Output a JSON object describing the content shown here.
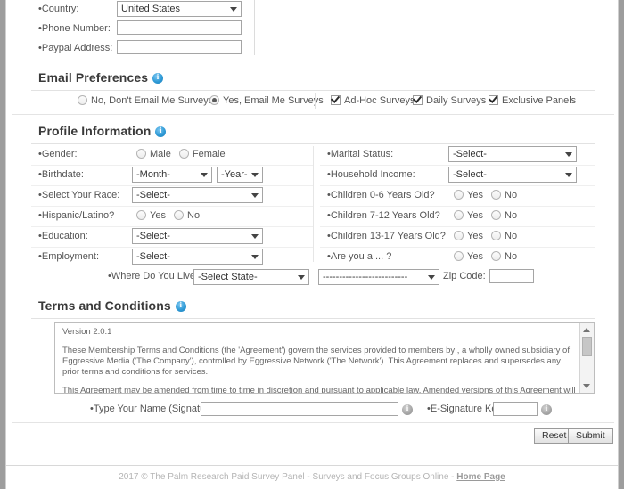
{
  "account": {
    "country": {
      "label": "•Country:",
      "value": "United States"
    },
    "phone": {
      "label": "•Phone Number:",
      "value": ""
    },
    "paypal": {
      "label": "•Paypal Address:",
      "value": ""
    }
  },
  "email_preferences": {
    "title": "Email Preferences",
    "info_icon": "info-icon",
    "radios": [
      {
        "label": "No, Don't Email Me Surveys",
        "selected": false
      },
      {
        "label": "Yes, Email Me Surveys",
        "selected": true
      }
    ],
    "checkboxes": [
      {
        "label": "Ad-Hoc Surveys",
        "checked": true
      },
      {
        "label": "Daily Surveys",
        "checked": true
      },
      {
        "label": "Exclusive Panels",
        "checked": true
      }
    ]
  },
  "profile_information": {
    "title": "Profile Information",
    "info_icon": "info-icon",
    "left": {
      "gender": {
        "label": "•Gender:",
        "options": [
          "Male",
          "Female"
        ]
      },
      "birthdate": {
        "label": "•Birthdate:",
        "month": "-Month-",
        "year": "-Year-"
      },
      "race": {
        "label": "•Select Your Race:",
        "value": "-Select-"
      },
      "hispanic": {
        "label": "•Hispanic/Latino?",
        "options": [
          "Yes",
          "No"
        ]
      },
      "education": {
        "label": "•Education:",
        "value": "-Select-"
      },
      "employment": {
        "label": "•Employment:",
        "value": "-Select-"
      }
    },
    "right": {
      "marital": {
        "label": "•Marital Status:",
        "value": "-Select-"
      },
      "income": {
        "label": "•Household Income:",
        "value": "-Select-"
      },
      "children_0_6": {
        "label": "•Children 0-6 Years Old?",
        "options": [
          "Yes",
          "No"
        ]
      },
      "children_7_12": {
        "label": "•Children 7-12 Years Old?",
        "options": [
          "Yes",
          "No"
        ]
      },
      "children_13_17": {
        "label": "•Children 13-17 Years Old?",
        "options": [
          "Yes",
          "No"
        ]
      },
      "are_you_a": {
        "label": "•Are you a ... ?",
        "options": [
          "Yes",
          "No"
        ]
      }
    },
    "residence": {
      "label": "•Where Do You Live?",
      "state": "-Select State-",
      "region": "--------------------------",
      "zip_label": "Zip Code:",
      "zip_value": ""
    }
  },
  "terms": {
    "title": "Terms and Conditions",
    "info_icon": "info-icon",
    "version": "Version 2.0.1",
    "paragraph_1": "These Membership Terms and Conditions (the 'Agreement') govern the services provided to members by , a wholly owned subsidiary of Eggressive Media ('The Company'), controlled by Eggressive Network ('The Network'). This Agreement replaces and supersedes any prior terms and conditions for services.",
    "paragraph_2": "This Agreement may be amended from time to time in discretion and pursuant to applicable law. Amended versions of this Agreement will be effective upon posting at http://termsofmembership.html"
  },
  "signature": {
    "name_label": "•Type Your Name (Signature)",
    "name_value": "",
    "key_label": "•E-Signature Key",
    "key_value": ""
  },
  "actions": {
    "reset": "Reset",
    "submit": "Submit"
  },
  "footer": {
    "text": "2017 © The Palm Research Paid Survey Panel - Surveys and Focus Groups Online - ",
    "link": "Home Page"
  }
}
